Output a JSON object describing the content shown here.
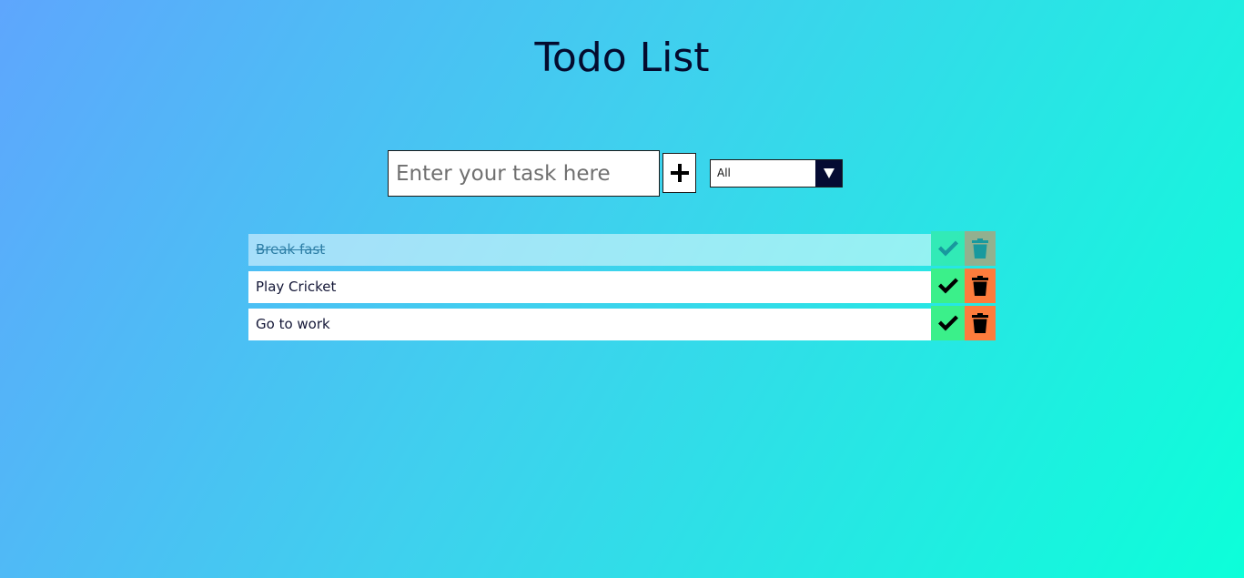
{
  "header": {
    "title": "Todo List"
  },
  "form": {
    "input_placeholder": "Enter your task here",
    "input_value": "",
    "add_icon": "plus-icon",
    "filter": {
      "selected": "All",
      "arrow_icon": "caret-down-icon"
    }
  },
  "todos": [
    {
      "text": "Break fast",
      "completed": true
    },
    {
      "text": "Play Cricket",
      "completed": false
    },
    {
      "text": "Go to work",
      "completed": false
    }
  ],
  "colors": {
    "complete_button": "#3bf08a",
    "delete_button": "#fd7c3c",
    "filter_arrow_bg": "#050b33",
    "title": "#040b2e"
  },
  "icons": {
    "complete": "check-icon",
    "delete": "trash-icon"
  }
}
